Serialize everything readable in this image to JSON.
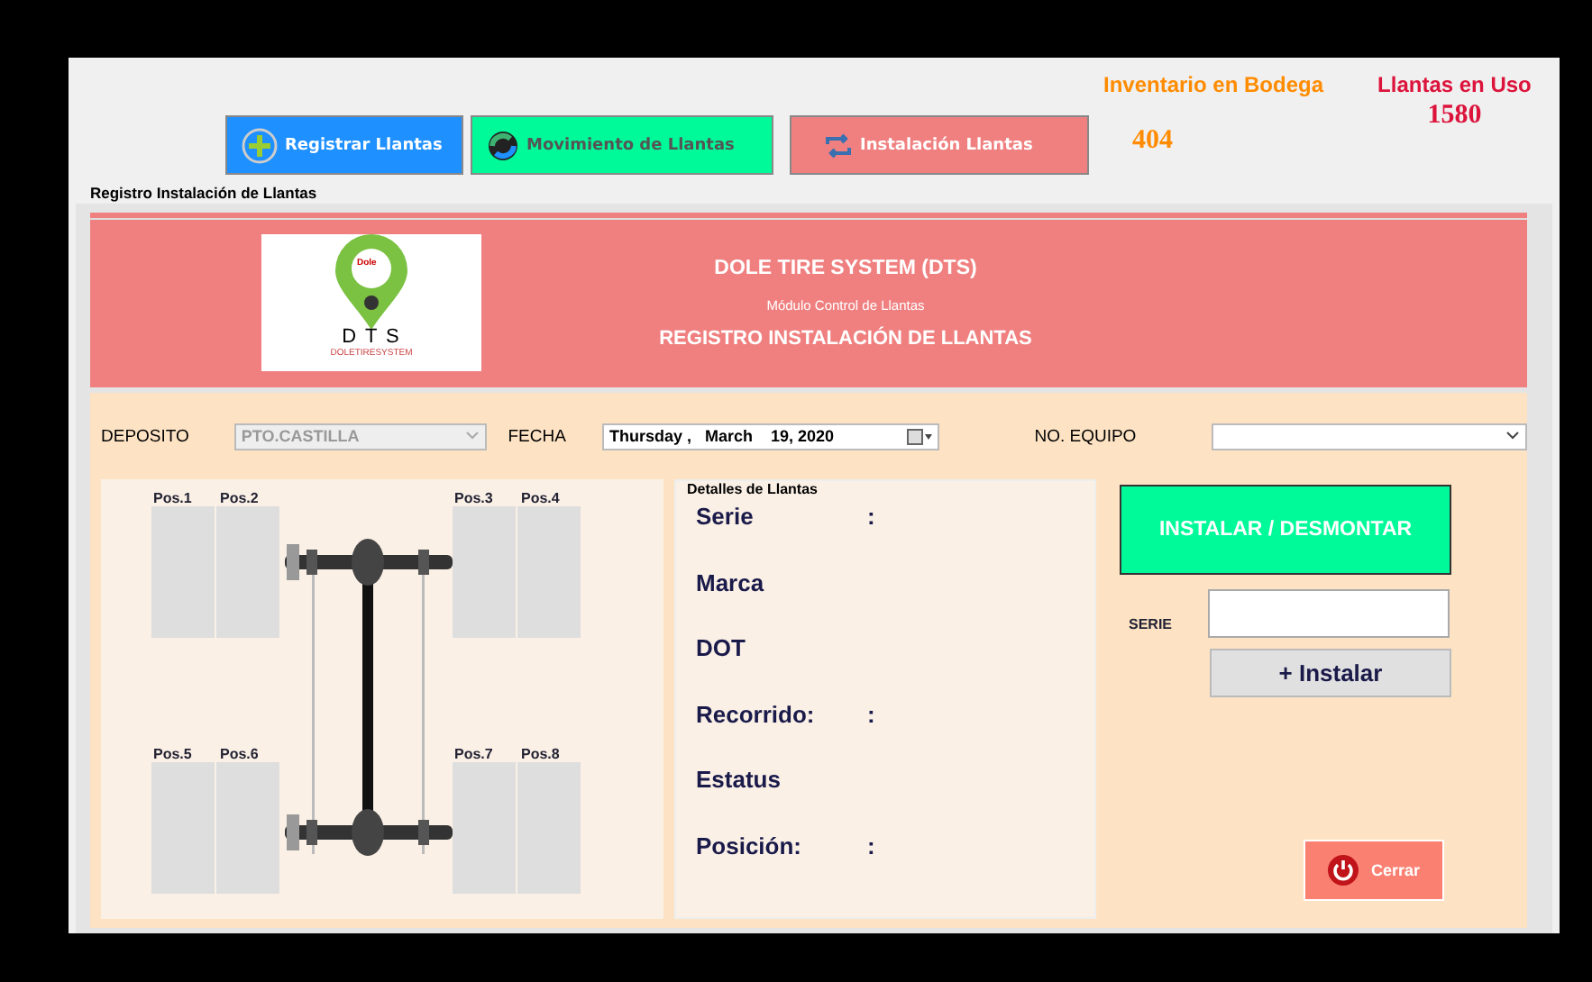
{
  "nav_buttons": [
    {
      "label": "Registrar Llantas",
      "kind": "plus",
      "color": "#1e90ff"
    },
    {
      "label": "Movimiento de Llantas",
      "kind": "cycle",
      "color": "#00fa9a"
    },
    {
      "label": "Instalación Llantas",
      "kind": "swap",
      "color": "#f08080"
    }
  ],
  "counters": [
    {
      "title": "Inventario en Bodega",
      "value": "404",
      "color": "#ff8c00"
    },
    {
      "title": "Llantas en Uso",
      "value": "1580",
      "color": "#dc143c"
    }
  ],
  "group_title": "Registro Instalación de Llantas",
  "header": {
    "logo": {
      "pin_text": "Dole",
      "title": "D T S",
      "subtitle": "DOLETIRESYSTEM"
    },
    "title": "DOLE TIRE SYSTEM (DTS)",
    "subtitle": "Módulo Control de Llantas",
    "heading": "REGISTRO INSTALACIÓN DE LLANTAS"
  },
  "form": {
    "deposito": {
      "label": "DEPOSITO",
      "value": "PTO.CASTILLA",
      "disabled": true
    },
    "fecha": {
      "label": "FECHA",
      "value": "Thursday ,   March    19, 2020"
    },
    "equipo": {
      "label": "NO. EQUIPO"
    }
  },
  "positions": [
    "Pos.1",
    "Pos.2",
    "Pos.3",
    "Pos.4",
    "Pos.5",
    "Pos.6",
    "Pos.7",
    "Pos.8"
  ],
  "details": {
    "legend": "Detalles de Llantas",
    "fields": [
      {
        "label": "Serie",
        "separator": ":"
      },
      {
        "label": "Marca"
      },
      {
        "label": "DOT"
      },
      {
        "label": "Recorrido:",
        "separator": ":"
      },
      {
        "label": "Estatus"
      },
      {
        "label": "Posición:",
        "separator": ":"
      }
    ]
  },
  "actions": {
    "main_button": "INSTALAR / DESMONTAR",
    "serie_label": "SERIE",
    "install_button": "+ Instalar",
    "close_button": "Cerrar"
  }
}
